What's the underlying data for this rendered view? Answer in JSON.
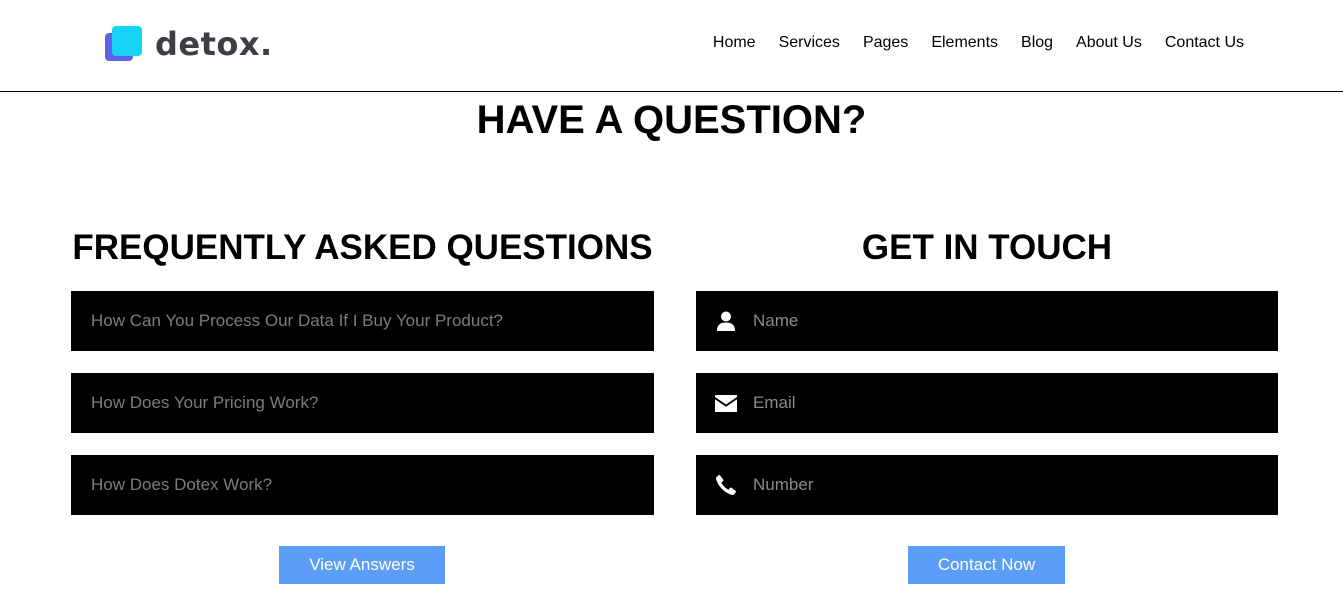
{
  "brand": {
    "name": "detox."
  },
  "nav": {
    "items": [
      "Home",
      "Services",
      "Pages",
      "Elements",
      "Blog",
      "About Us",
      "Contact Us"
    ]
  },
  "main": {
    "title": "HAVE A QUESTION?"
  },
  "faq": {
    "title": "FREQUENTLY ASKED QUESTIONS",
    "questions": [
      "How Can You Process Our Data If I Buy Your Product?",
      "How Does Your Pricing Work?",
      "How Does Dotex Work?"
    ],
    "button_label": "View Answers"
  },
  "contact": {
    "title": "GET IN TOUCH",
    "fields": [
      {
        "placeholder": "Name",
        "icon": "user-icon"
      },
      {
        "placeholder": "Email",
        "icon": "envelope-icon"
      },
      {
        "placeholder": "Number",
        "icon": "phone-icon"
      }
    ],
    "button_label": "Contact Now"
  },
  "colors": {
    "button": "#5c9ef7",
    "logo_front": "#19d3f6",
    "logo_back": "#5b63e6",
    "box": "#000000"
  }
}
